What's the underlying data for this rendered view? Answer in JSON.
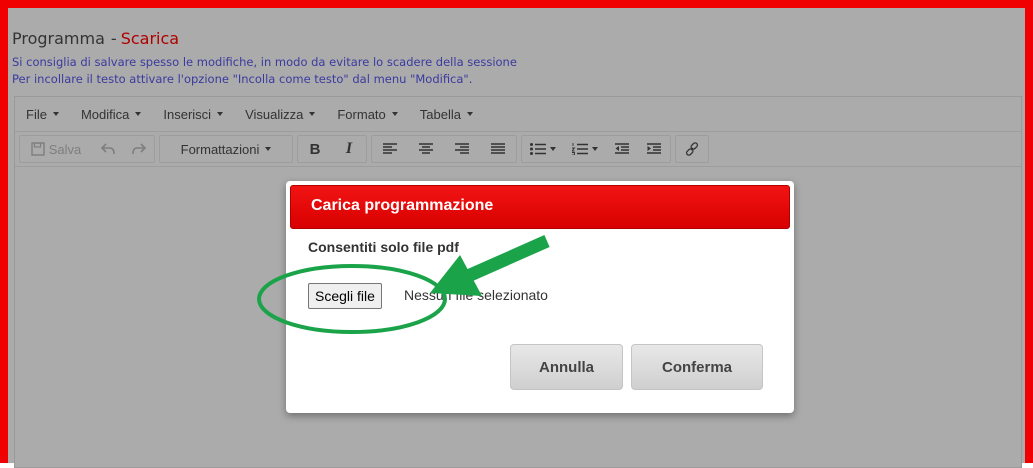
{
  "header": {
    "title": "Programma",
    "separator": "-",
    "download_link": "Scarica",
    "hint_save": "Si consiglia di salvare spesso le modifiche, in modo da evitare lo scadere della sessione",
    "hint_paste": "Per incollare il testo attivare l'opzione \"Incolla come testo\" dal menu \"Modifica\"."
  },
  "menubar": {
    "items": [
      {
        "label": "File"
      },
      {
        "label": "Modifica"
      },
      {
        "label": "Inserisci"
      },
      {
        "label": "Visualizza"
      },
      {
        "label": "Formato"
      },
      {
        "label": "Tabella"
      }
    ]
  },
  "toolbar": {
    "save_label": "Salva",
    "formats_label": "Formattazioni",
    "bold_label": "B",
    "italic_label": "I"
  },
  "modal": {
    "title": "Carica programmazione",
    "subtitle": "Consentiti solo file pdf",
    "file_button": "Scegli file",
    "file_status": "Nessun file selezionato",
    "cancel_label": "Annulla",
    "confirm_label": "Conferma"
  },
  "colors": {
    "frame": "#f00000",
    "modal_header": "#e00000",
    "annotation": "#1ba34a"
  },
  "annotations": {
    "arrow": "green-arrow-icon",
    "circle": "green-ellipse-highlight"
  }
}
